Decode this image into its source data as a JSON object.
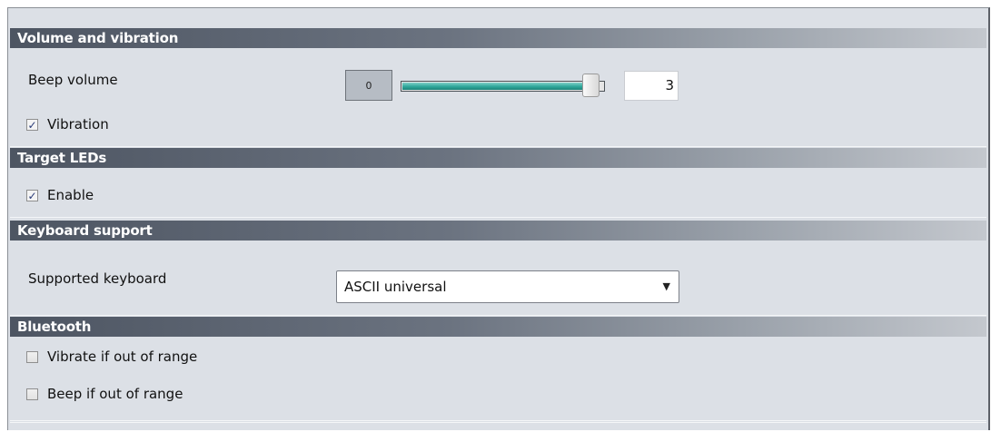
{
  "volume_section": {
    "title": "Volume and vibration",
    "beep_volume_label": "Beep volume",
    "slider_min": "0",
    "slider_value": "3",
    "slider_level": 1.0,
    "vibration_label": "Vibration",
    "vibration_checked": true
  },
  "leds_section": {
    "title": "Target LEDs",
    "enable_label": "Enable",
    "enable_checked": true
  },
  "keyboard_section": {
    "title": "Keyboard support",
    "supported_keyboard_label": "Supported keyboard",
    "selected_keyboard": "ASCII universal"
  },
  "bluetooth_section": {
    "title": "Bluetooth",
    "vibrate_label": "Vibrate if out of range",
    "vibrate_checked": false,
    "beep_label": "Beep if out of range",
    "beep_checked": false
  },
  "icons": {
    "checkmark": "✓",
    "dropdown": "▼"
  },
  "colors": {
    "slider_fill": "#2fa79b",
    "header_dark": "#4d5562",
    "panel_bg": "#dce0e6"
  }
}
